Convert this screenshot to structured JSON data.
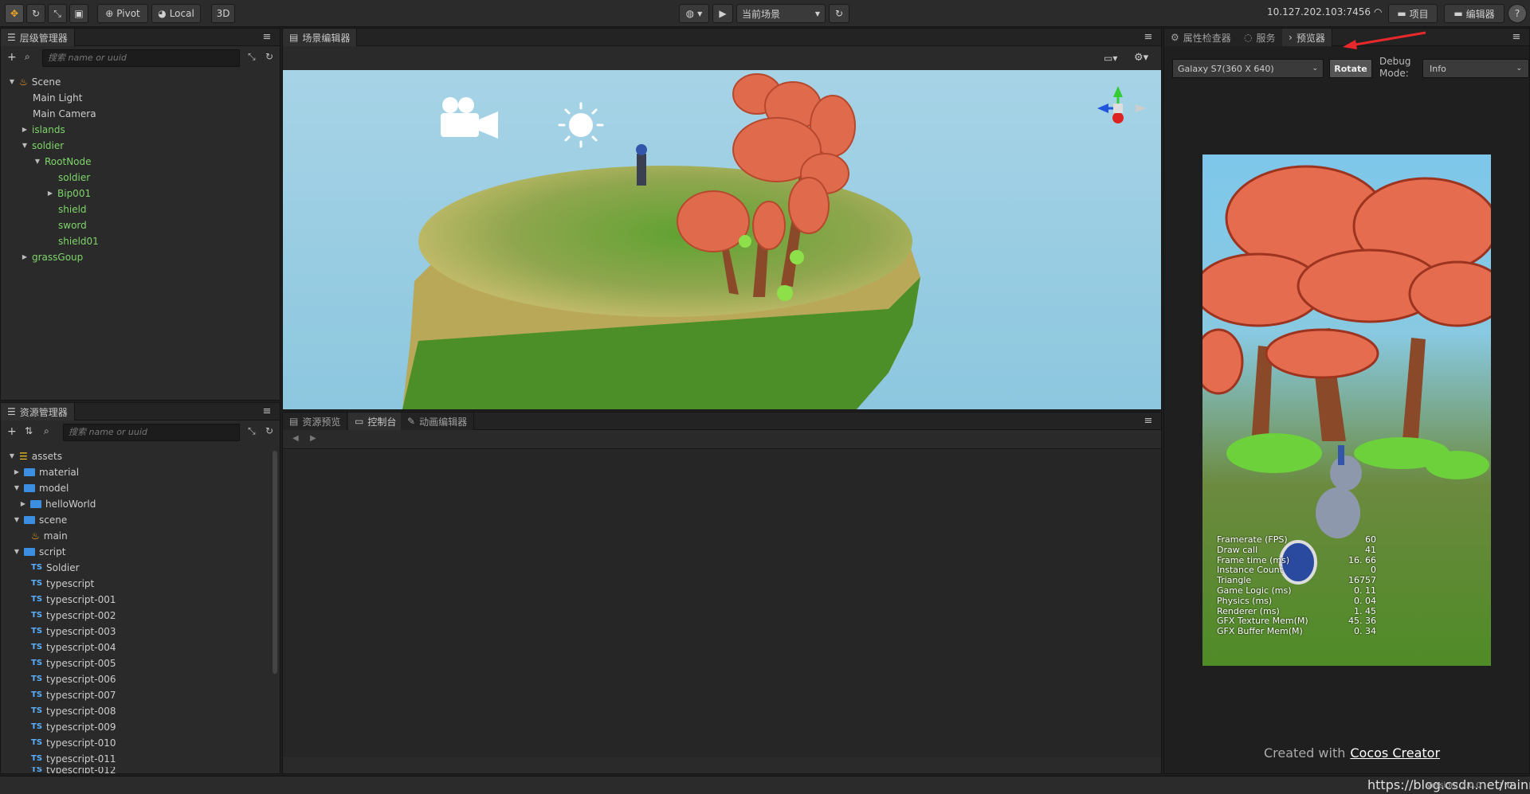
{
  "toolbar": {
    "pivot_label": "Pivot",
    "local_label": "Local",
    "mode_3d_label": "3D",
    "scene_select": "当前场景",
    "ip_address": "10.127.202.103:7456",
    "project_label": "项目",
    "editor_label": "编辑器",
    "help_label": "?"
  },
  "hierarchy": {
    "tab_label": "层级管理器",
    "search_placeholder": "搜索 name or uuid",
    "items": [
      {
        "label": "Scene"
      },
      {
        "label": "Main Light"
      },
      {
        "label": "Main Camera"
      },
      {
        "label": "islands"
      },
      {
        "label": "soldier"
      },
      {
        "label": "RootNode"
      },
      {
        "label": "soldier"
      },
      {
        "label": "Bip001"
      },
      {
        "label": "shield"
      },
      {
        "label": "sword"
      },
      {
        "label": "shield01"
      },
      {
        "label": "grassGoup"
      }
    ]
  },
  "assets": {
    "tab_label": "资源管理器",
    "search_placeholder": "搜索 name or uuid",
    "ts_badge": "TS",
    "items": [
      {
        "label": "assets"
      },
      {
        "label": "material"
      },
      {
        "label": "model"
      },
      {
        "label": "helloWorld"
      },
      {
        "label": "scene"
      },
      {
        "label": "main"
      },
      {
        "label": "script"
      },
      {
        "label": "Soldier"
      },
      {
        "label": "typescript"
      },
      {
        "label": "typescript-001"
      },
      {
        "label": "typescript-002"
      },
      {
        "label": "typescript-003"
      },
      {
        "label": "typescript-004"
      },
      {
        "label": "typescript-005"
      },
      {
        "label": "typescript-006"
      },
      {
        "label": "typescript-007"
      },
      {
        "label": "typescript-008"
      },
      {
        "label": "typescript-009"
      },
      {
        "label": "typescript-010"
      },
      {
        "label": "typescript-011"
      },
      {
        "label": "typescript-012"
      }
    ]
  },
  "scene_editor": {
    "tab_label": "场景编辑器"
  },
  "bottom_panel": {
    "tabs": [
      {
        "label": "资源预览"
      },
      {
        "label": "控制台"
      },
      {
        "label": "动画编辑器"
      }
    ]
  },
  "right_panel": {
    "tabs": [
      {
        "label": "属性检查器"
      },
      {
        "label": "服务"
      },
      {
        "label": "预览器"
      }
    ],
    "device_select": "Galaxy S7(360 X 640)",
    "rotate_label": "Rotate",
    "debug_mode_label": "Debug Mode:",
    "debug_mode_value": "Info",
    "created_with": "Created with",
    "cocos_link": "Cocos Creator"
  },
  "stats": [
    {
      "name": "Framerate (FPS)",
      "value": "60"
    },
    {
      "name": "Draw call",
      "value": "41"
    },
    {
      "name": "Frame time (ms)",
      "value": "16. 66"
    },
    {
      "name": "Instance Count",
      "value": "0"
    },
    {
      "name": "Triangle",
      "value": "16757"
    },
    {
      "name": "Game Logic (ms)",
      "value": "0. 11"
    },
    {
      "name": "Physics (ms)",
      "value": "0. 04"
    },
    {
      "name": "Renderer (ms)",
      "value": "1. 45"
    },
    {
      "name": "GFX Texture Mem(M)",
      "value": "45. 36"
    },
    {
      "name": "GFX Buffer Mem(M)",
      "value": "0. 34"
    }
  ],
  "statusbar": {
    "watermark": "https://blog.csdn.net/rainrn",
    "version": "Version: 3.0.0",
    "count": "0"
  },
  "colors": {
    "green_node": "#7ed66a",
    "ts_blue": "#5ab0ff",
    "folder_blue": "#3b8ee0",
    "red_arrow": "#e8282a"
  }
}
